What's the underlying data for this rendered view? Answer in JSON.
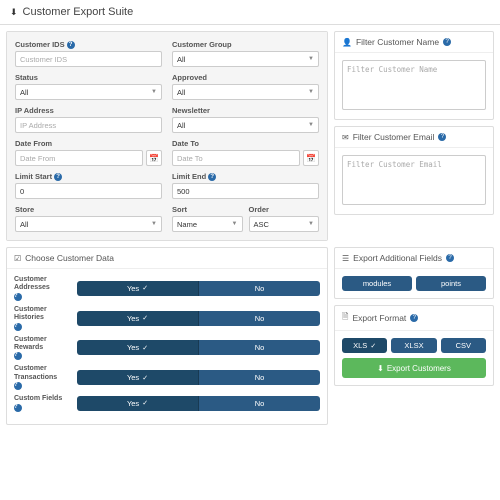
{
  "header": {
    "title": "Customer Export Suite"
  },
  "filters": {
    "customer_ids": {
      "label": "Customer IDS",
      "placeholder": "Customer IDS",
      "help": true
    },
    "customer_group": {
      "label": "Customer Group",
      "value": "All"
    },
    "status": {
      "label": "Status",
      "value": "All"
    },
    "approved": {
      "label": "Approved",
      "value": "All"
    },
    "ip_address": {
      "label": "IP Address",
      "placeholder": "IP Address"
    },
    "newsletter": {
      "label": "Newsletter",
      "value": "All"
    },
    "date_from": {
      "label": "Date From",
      "placeholder": "Date From"
    },
    "date_to": {
      "label": "Date To",
      "placeholder": "Date To"
    },
    "limit_start": {
      "label": "Limit Start",
      "value": "0",
      "help": true
    },
    "limit_end": {
      "label": "Limit End",
      "value": "500",
      "help": true
    },
    "store": {
      "label": "Store",
      "value": "All"
    },
    "sort": {
      "label": "Sort",
      "value": "Name"
    },
    "order": {
      "label": "Order",
      "value": "ASC"
    }
  },
  "filter_name": {
    "title": "Filter Customer Name",
    "placeholder": "Filter Customer Name",
    "help": true
  },
  "filter_email": {
    "title": "Filter Customer Email",
    "placeholder": "Filter Customer Email",
    "help": true
  },
  "customer_data": {
    "title": "Choose Customer Data",
    "yes": "Yes",
    "no": "No",
    "rows": [
      {
        "label": "Customer Addresses",
        "help": true
      },
      {
        "label": "Customer Histories",
        "help": true
      },
      {
        "label": "Customer Rewards",
        "help": true
      },
      {
        "label": "Customer Transactions",
        "help": true
      },
      {
        "label": "Custom Fields",
        "help": true
      }
    ]
  },
  "additional": {
    "title": "Export Additional Fields",
    "help": true,
    "buttons": [
      "modules",
      "points"
    ]
  },
  "format": {
    "title": "Export Format",
    "help": true,
    "options": [
      "XLS",
      "XLSX",
      "CSV"
    ],
    "selected": "XLS",
    "export_label": "Export Customers"
  }
}
